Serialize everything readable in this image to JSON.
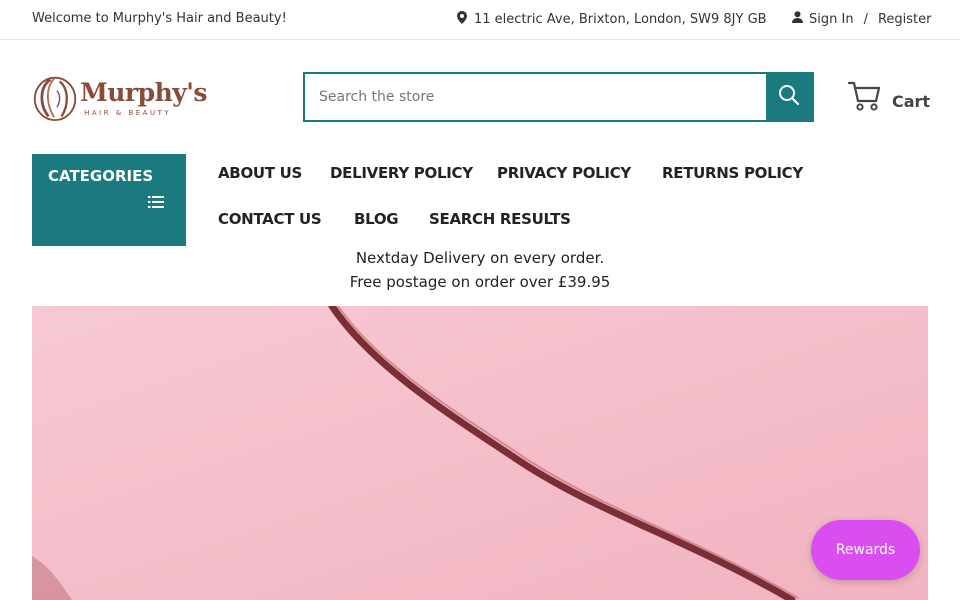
{
  "topbar": {
    "welcome": "Welcome to Murphy's Hair and Beauty!",
    "address": "11 electric Ave, Brixton, London, SW9 8JY GB",
    "sign_in": "Sign In",
    "separator": "/",
    "register": "Register"
  },
  "logo": {
    "name": "Murphy's",
    "tagline": "HAIR & BEAUTY"
  },
  "search": {
    "placeholder": "Search the store"
  },
  "cart": {
    "label": "Cart"
  },
  "categories": {
    "label": "CATEGORIES"
  },
  "nav": {
    "items": [
      {
        "label": "ABOUT US"
      },
      {
        "label": "DELIVERY POLICY"
      },
      {
        "label": "PRIVACY POLICY"
      },
      {
        "label": "RETURNS POLICY"
      },
      {
        "label": "CONTACT US"
      },
      {
        "label": "BLOG"
      },
      {
        "label": "SEARCH RESULTS"
      }
    ]
  },
  "promo": {
    "line1": "Nextday Delivery on every order.",
    "line2": "Free postage on order over £39.95"
  },
  "rewards": {
    "label": "Rewards"
  },
  "colors": {
    "accent": "#1b7a80",
    "brand": "#8a4b3a",
    "rewards": "#d94ef0",
    "hero_bg": "#f4b7c4"
  },
  "icons": [
    "map-pin-icon",
    "user-icon",
    "search-icon",
    "cart-icon",
    "list-icon"
  ]
}
